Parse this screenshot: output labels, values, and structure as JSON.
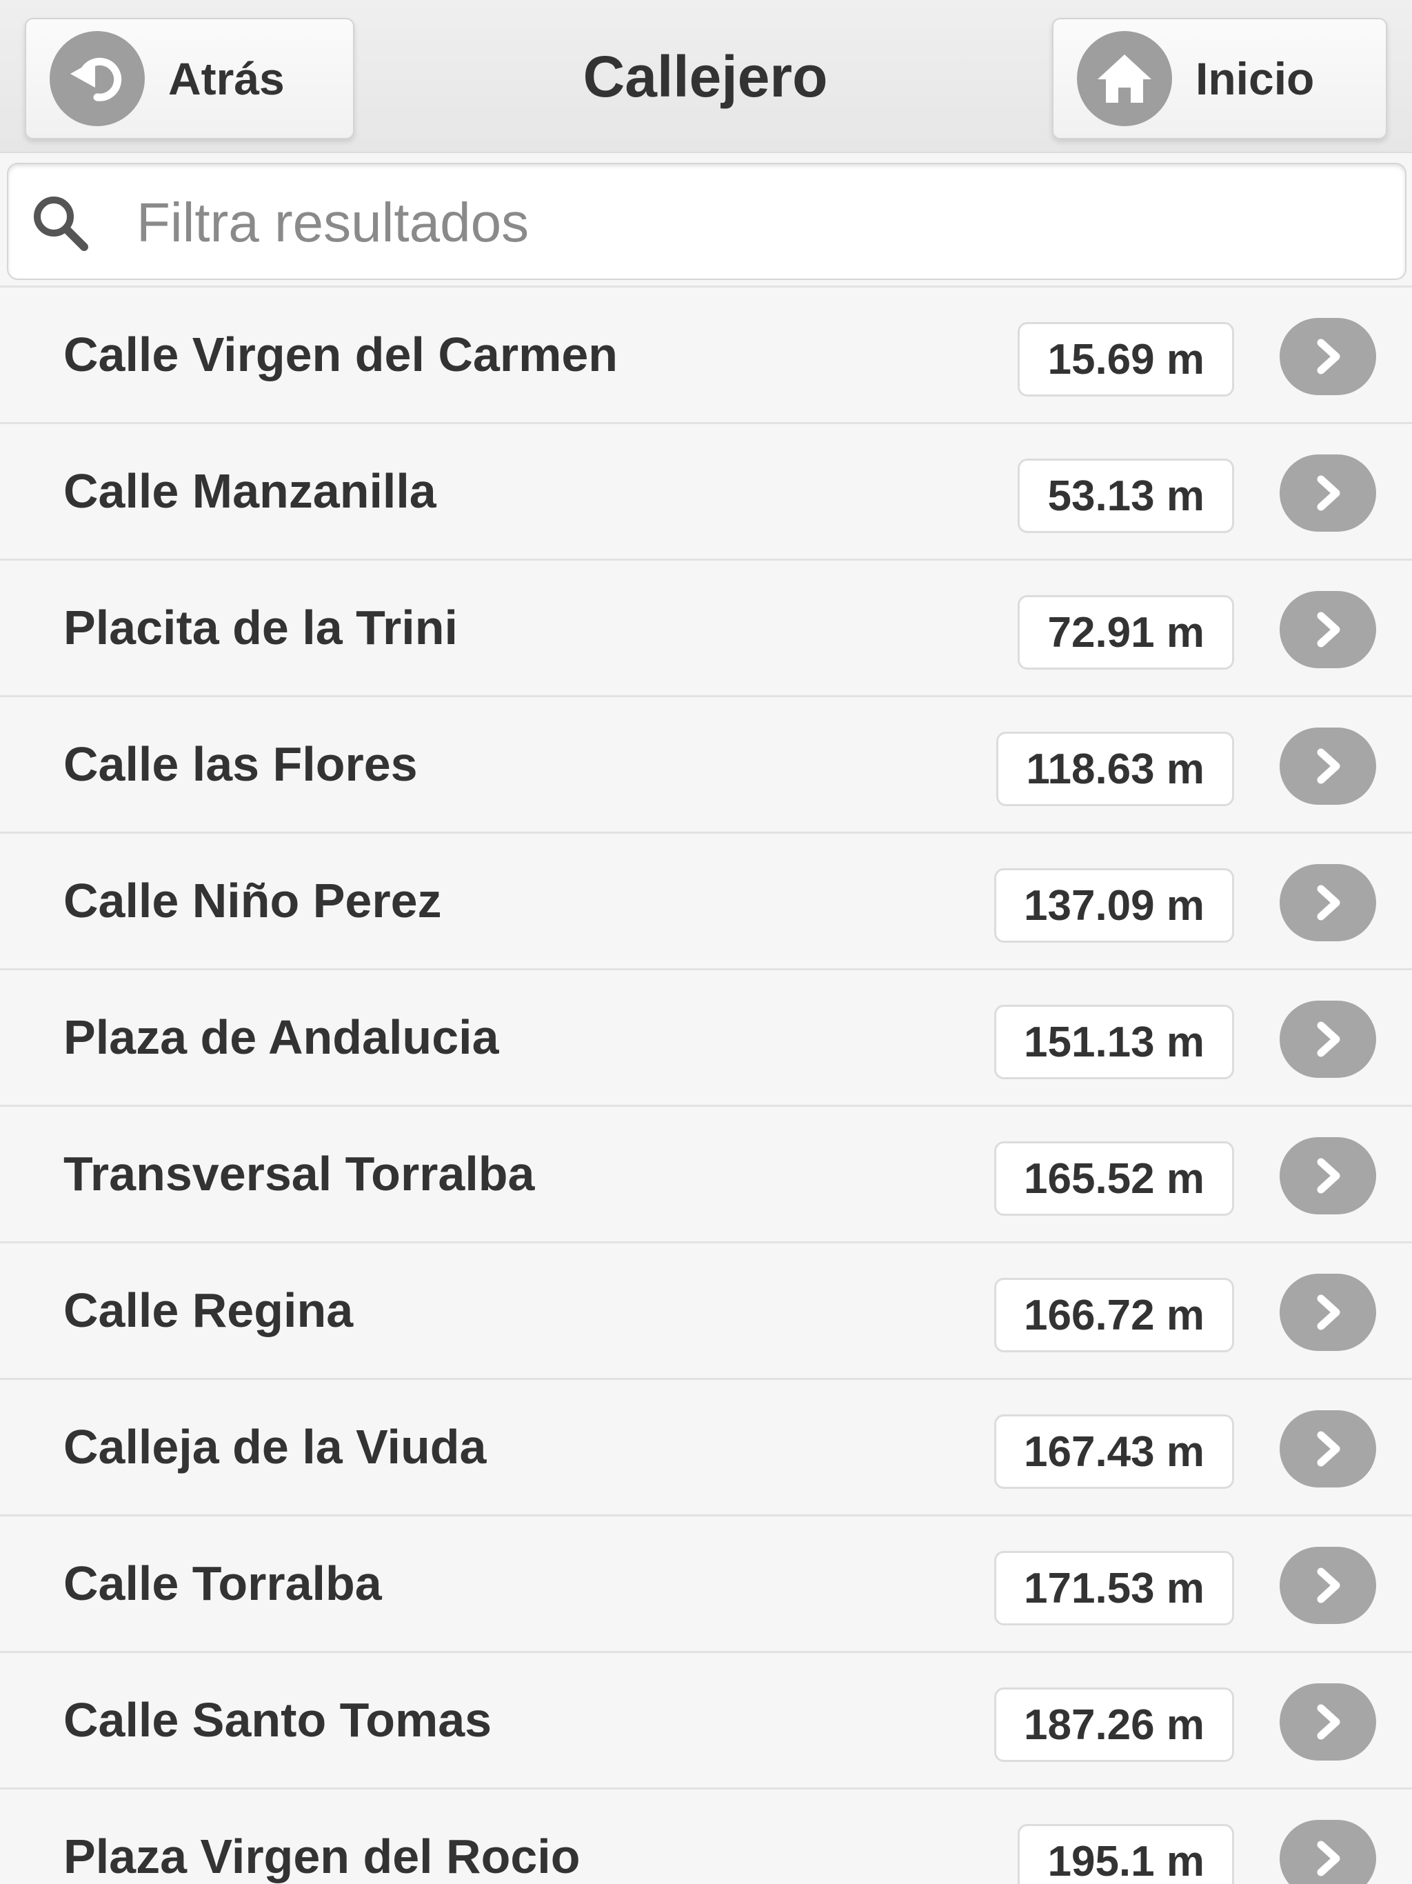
{
  "header": {
    "title": "Callejero",
    "back_label": "Atrás",
    "home_label": "Inicio"
  },
  "search": {
    "placeholder": "Filtra resultados",
    "value": ""
  },
  "streets": [
    {
      "name": "Calle Virgen del Carmen",
      "distance": "15.69 m"
    },
    {
      "name": "Calle Manzanilla",
      "distance": "53.13 m"
    },
    {
      "name": "Placita de la Trini",
      "distance": "72.91 m"
    },
    {
      "name": "Calle las Flores",
      "distance": "118.63 m"
    },
    {
      "name": "Calle Niño Perez",
      "distance": "137.09 m"
    },
    {
      "name": "Plaza de Andalucia",
      "distance": "151.13 m"
    },
    {
      "name": "Transversal Torralba",
      "distance": "165.52 m"
    },
    {
      "name": "Calle Regina",
      "distance": "166.72 m"
    },
    {
      "name": "Calleja de la Viuda",
      "distance": "167.43 m"
    },
    {
      "name": "Calle Torralba",
      "distance": "171.53 m"
    },
    {
      "name": "Calle Santo Tomas",
      "distance": "187.26 m"
    },
    {
      "name": "Plaza Virgen del Rocio",
      "distance": "195.1 m"
    }
  ],
  "icons": {
    "back": "back-arrow-icon",
    "home": "home-icon",
    "search": "search-icon",
    "row_action": "chevron-right-icon"
  },
  "colors": {
    "icon_bg": "#9e9e9e",
    "text": "#333333",
    "page_bg": "#f6f6f6"
  }
}
